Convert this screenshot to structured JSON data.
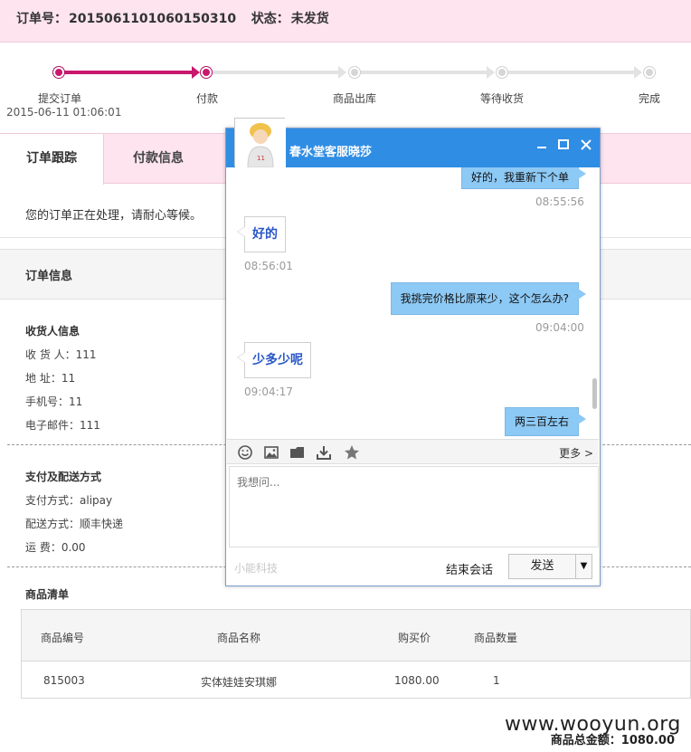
{
  "order": {
    "number_label": "订单号：",
    "number": "2015061101060150310",
    "status_label": "状态：",
    "status": "未发货"
  },
  "progress": {
    "steps": [
      "提交订单",
      "付款",
      "商品出库",
      "等待收货",
      "完成"
    ],
    "submit_time": "2015-06-11 01:06:01",
    "completed_steps": 2
  },
  "tabs": [
    "订单跟踪",
    "付款信息"
  ],
  "status_message": "您的订单正在处理，请耐心等候。",
  "order_info_title": "订单信息",
  "receiver": {
    "title": "收货人信息",
    "rows": [
      "收 货 人：111",
      "地    址：11",
      "手机号：11",
      "电子邮件：111"
    ]
  },
  "payment": {
    "title": "支付及配送方式",
    "rows": [
      "支付方式：alipay",
      "配送方式：顺丰快递",
      "运    费：0.00"
    ]
  },
  "products": {
    "title": "商品清单",
    "headers": [
      "商品编号",
      "商品名称",
      "购买价",
      "商品数量"
    ],
    "rows": [
      [
        "815003",
        "实体娃娃安琪娜",
        "1080.00",
        "1"
      ]
    ],
    "total": "商品总金额：1080.00"
  },
  "watermark": "www.wooyun.org",
  "chat": {
    "title": "春水堂客服晓莎",
    "messages": [
      {
        "side": "right",
        "text": "好的，我重新下个单",
        "time": "08:55:56"
      },
      {
        "side": "left",
        "text": "好的",
        "time": "08:56:01"
      },
      {
        "side": "right",
        "text": "我挑完价格比原来少，这个怎么办?",
        "time": "09:04:00"
      },
      {
        "side": "left",
        "text": "少多少呢",
        "time": "09:04:17"
      },
      {
        "side": "right",
        "text": "两三百左右",
        "time": ""
      }
    ],
    "more": "更多 >",
    "placeholder": "我想问...",
    "brand": "小能科技",
    "end_label": "结束会话",
    "send_label": "发送",
    "send_drop": "▼",
    "accent": "#2f8de4"
  }
}
